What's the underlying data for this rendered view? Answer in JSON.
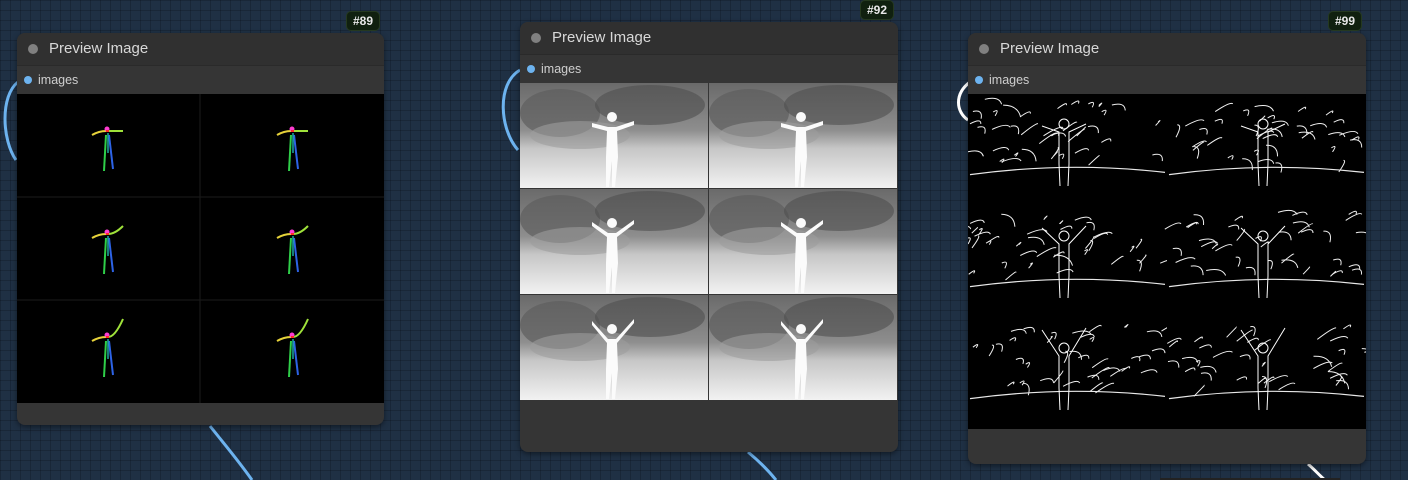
{
  "canvas": {
    "background_color": "#1f3044",
    "link_color": "#6db3ef"
  },
  "nodes": [
    {
      "title": "Preview Image",
      "id_badge": "#89",
      "input_label": "images",
      "preview_kind": "pose skeletons"
    },
    {
      "title": "Preview Image",
      "id_badge": "#92",
      "input_label": "images",
      "preview_kind": "depth maps"
    },
    {
      "title": "Preview Image",
      "id_badge": "#99",
      "input_label": "images",
      "preview_kind": "edge maps"
    }
  ]
}
